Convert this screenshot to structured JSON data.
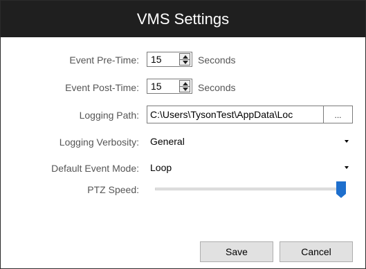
{
  "window": {
    "title": "VMS Settings"
  },
  "fields": {
    "pre_time": {
      "label": "Event Pre-Time:",
      "value": "15",
      "unit": "Seconds"
    },
    "post_time": {
      "label": "Event Post-Time:",
      "value": "15",
      "unit": "Seconds"
    },
    "logging_path": {
      "label": "Logging Path:",
      "value": "C:\\Users\\TysonTest\\AppData\\Loc",
      "browse_label": "..."
    },
    "logging_verbosity": {
      "label": "Logging Verbosity:",
      "value": "General"
    },
    "default_event_mode": {
      "label": "Default Event Mode:",
      "value": "Loop"
    },
    "ptz_speed": {
      "label": "PTZ Speed:",
      "level": 1.0
    }
  },
  "buttons": {
    "save": "Save",
    "cancel": "Cancel"
  },
  "colors": {
    "titlebar": "#1f1f1f",
    "accent": "#1e6fcd"
  },
  "icons": [
    "spin-up-icon",
    "spin-down-icon",
    "dropdown-caret-icon"
  ]
}
